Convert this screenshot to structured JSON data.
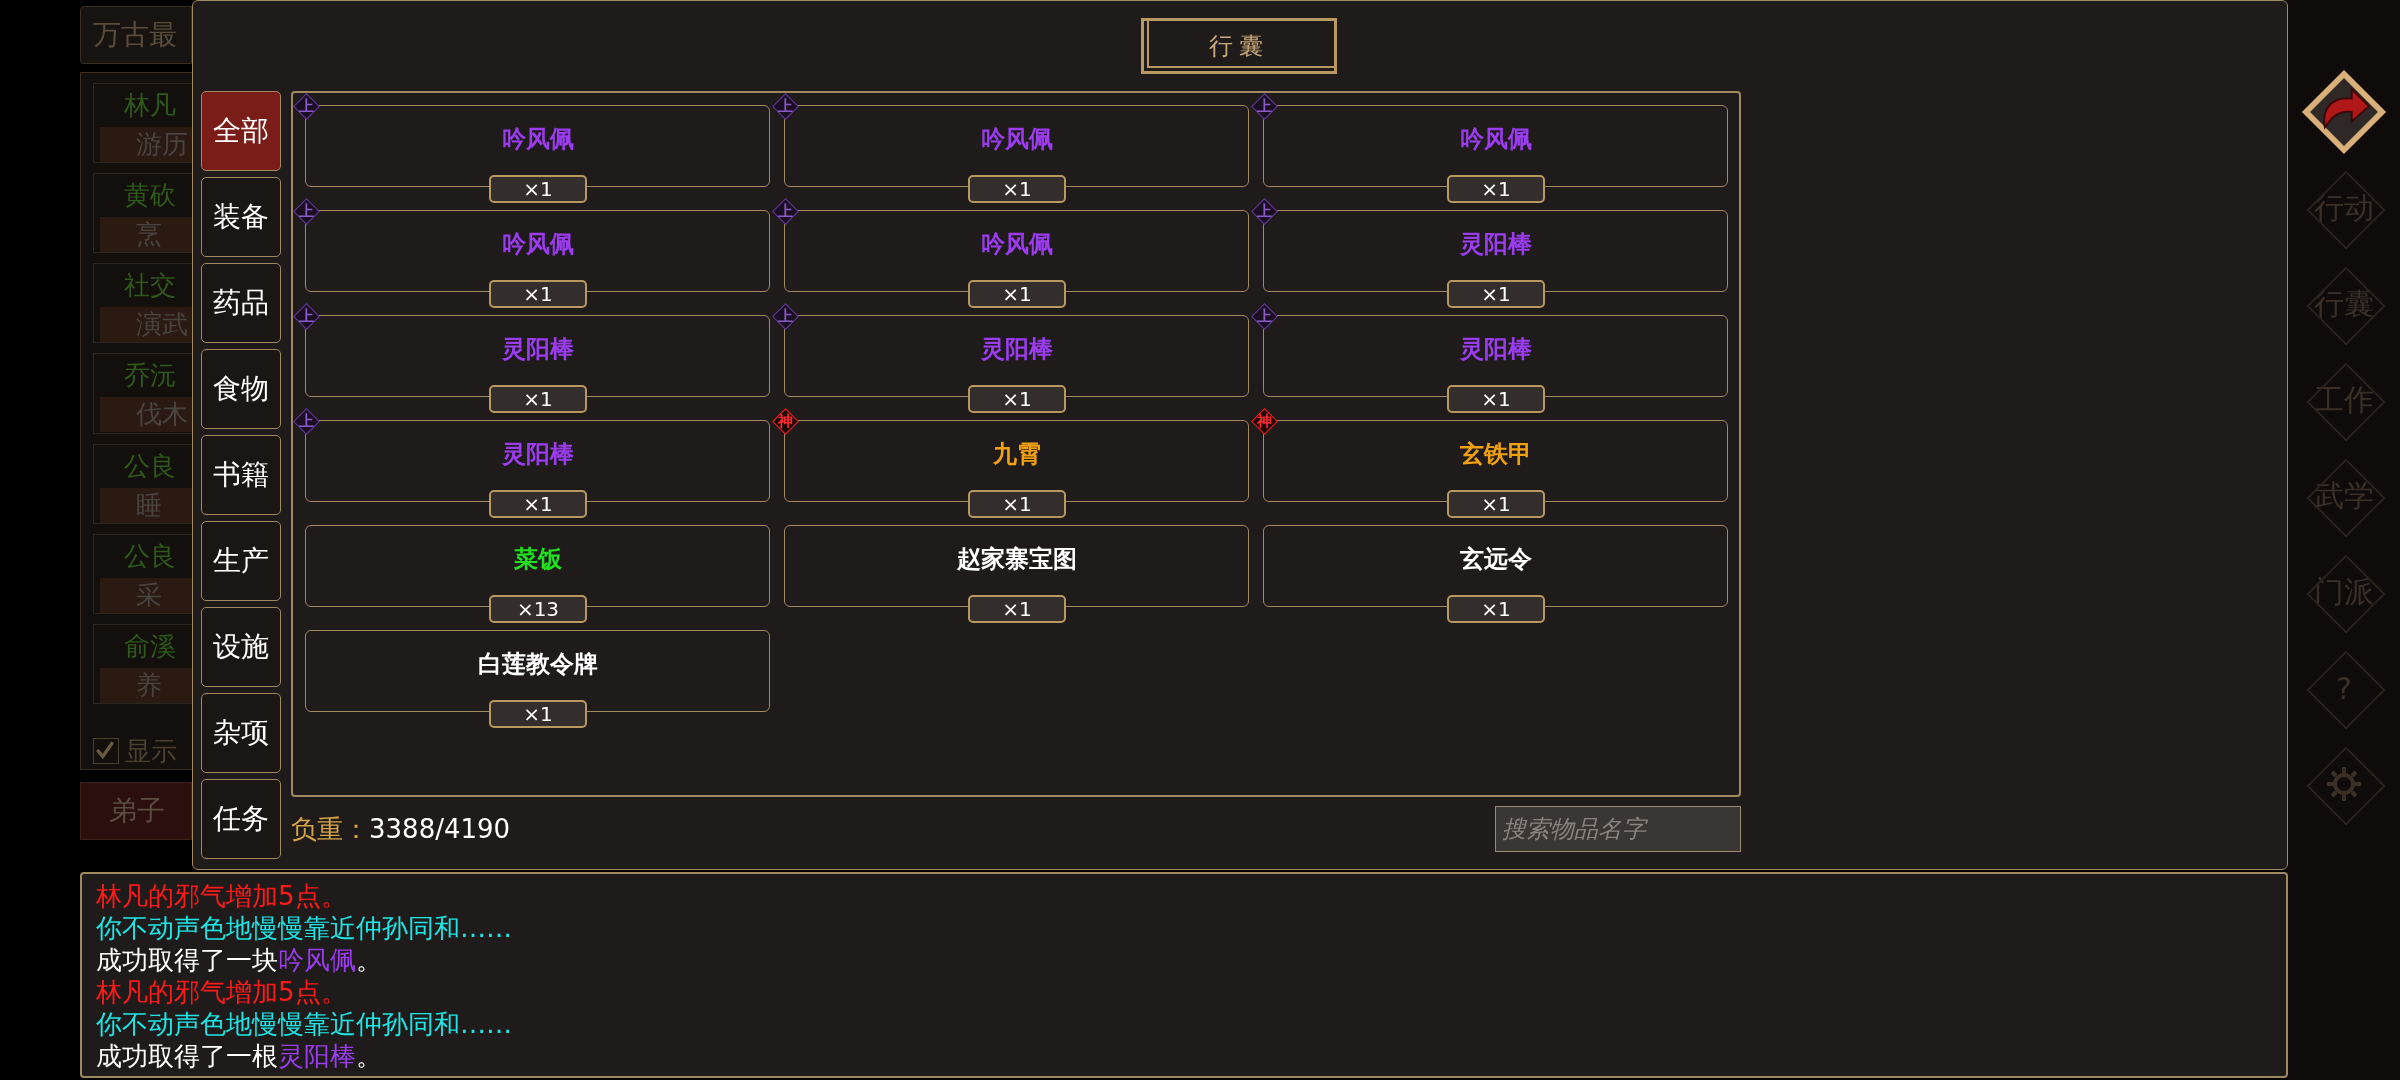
{
  "background_panel": {
    "title": "万古最",
    "entries": [
      {
        "name": "林凡",
        "activity": "游历"
      },
      {
        "name": "黄砍",
        "activity": "烹"
      },
      {
        "name": "社交",
        "activity": "演武"
      },
      {
        "name": "乔沅",
        "activity": "伐木"
      },
      {
        "name": "公良",
        "activity": "睡"
      },
      {
        "name": "公良",
        "activity": "采"
      },
      {
        "name": "俞溪",
        "activity": "养"
      }
    ],
    "checkbox": {
      "label": "显示",
      "checked": true
    },
    "button": "弟子"
  },
  "window": {
    "title": "行囊"
  },
  "tabs": [
    {
      "label": "全部",
      "selected": true
    },
    {
      "label": "装备",
      "selected": false
    },
    {
      "label": "药品",
      "selected": false
    },
    {
      "label": "食物",
      "selected": false
    },
    {
      "label": "书籍",
      "selected": false
    },
    {
      "label": "生产",
      "selected": false
    },
    {
      "label": "设施",
      "selected": false
    },
    {
      "label": "杂项",
      "selected": false
    },
    {
      "label": "任务",
      "selected": false
    }
  ],
  "items": [
    {
      "name": "吟风佩",
      "color": "#9b3cf0",
      "grade": {
        "text": "上",
        "kind": "upper"
      },
      "count": "×1"
    },
    {
      "name": "吟风佩",
      "color": "#9b3cf0",
      "grade": {
        "text": "上",
        "kind": "upper"
      },
      "count": "×1"
    },
    {
      "name": "吟风佩",
      "color": "#9b3cf0",
      "grade": {
        "text": "上",
        "kind": "upper"
      },
      "count": "×1"
    },
    {
      "name": "吟风佩",
      "color": "#9b3cf0",
      "grade": {
        "text": "上",
        "kind": "upper"
      },
      "count": "×1"
    },
    {
      "name": "吟风佩",
      "color": "#9b3cf0",
      "grade": {
        "text": "上",
        "kind": "upper"
      },
      "count": "×1"
    },
    {
      "name": "灵阳棒",
      "color": "#9b3cf0",
      "grade": {
        "text": "上",
        "kind": "upper"
      },
      "count": "×1"
    },
    {
      "name": "灵阳棒",
      "color": "#9b3cf0",
      "grade": {
        "text": "上",
        "kind": "upper"
      },
      "count": "×1"
    },
    {
      "name": "灵阳棒",
      "color": "#9b3cf0",
      "grade": {
        "text": "上",
        "kind": "upper"
      },
      "count": "×1"
    },
    {
      "name": "灵阳棒",
      "color": "#9b3cf0",
      "grade": {
        "text": "上",
        "kind": "upper"
      },
      "count": "×1"
    },
    {
      "name": "灵阳棒",
      "color": "#9b3cf0",
      "grade": {
        "text": "上",
        "kind": "upper"
      },
      "count": "×1"
    },
    {
      "name": "九霄",
      "color": "#f0a010",
      "grade": {
        "text": "神",
        "kind": "divine"
      },
      "count": "×1"
    },
    {
      "name": "玄铁甲",
      "color": "#f0a010",
      "grade": {
        "text": "神",
        "kind": "divine"
      },
      "count": "×1"
    },
    {
      "name": "菜饭",
      "color": "#20e020",
      "count": "×13"
    },
    {
      "name": "赵家寨宝图",
      "color": "#ffffff",
      "count": "×1"
    },
    {
      "name": "玄远令",
      "color": "#ffffff",
      "count": "×1"
    },
    {
      "name": "白莲教令牌",
      "color": "#ffffff",
      "count": "×1"
    }
  ],
  "weight": {
    "label": "负重：",
    "value": "3388/4190"
  },
  "search": {
    "placeholder": "搜索物品名字"
  },
  "log": [
    {
      "color": "#ff1a1a",
      "parts": [
        {
          "text": "林凡的邪气增加5点。"
        }
      ]
    },
    {
      "color": "#1ee6e6",
      "parts": [
        {
          "text": "你不动声色地慢慢靠近仲孙同和……"
        }
      ]
    },
    {
      "color": "#ffffff",
      "parts": [
        {
          "text": "成功取得了一块"
        },
        {
          "text": "吟风佩",
          "color": "#9b3cf0"
        },
        {
          "text": "。"
        }
      ]
    },
    {
      "color": "#ff1a1a",
      "parts": [
        {
          "text": "林凡的邪气增加5点。"
        }
      ]
    },
    {
      "color": "#1ee6e6",
      "parts": [
        {
          "text": "你不动声色地慢慢靠近仲孙同和……"
        }
      ]
    },
    {
      "color": "#ffffff",
      "parts": [
        {
          "text": "成功取得了一根"
        },
        {
          "text": "灵阳棒",
          "color": "#9b3cf0"
        },
        {
          "text": "。"
        }
      ]
    }
  ],
  "side_menu": [
    {
      "kind": "back"
    },
    {
      "kind": "text",
      "label": "行动"
    },
    {
      "kind": "text",
      "label": "行囊"
    },
    {
      "kind": "text",
      "label": "工作"
    },
    {
      "kind": "text",
      "label": "武学"
    },
    {
      "kind": "text",
      "label": "门派"
    },
    {
      "kind": "text",
      "label": "?"
    },
    {
      "kind": "gear"
    }
  ]
}
